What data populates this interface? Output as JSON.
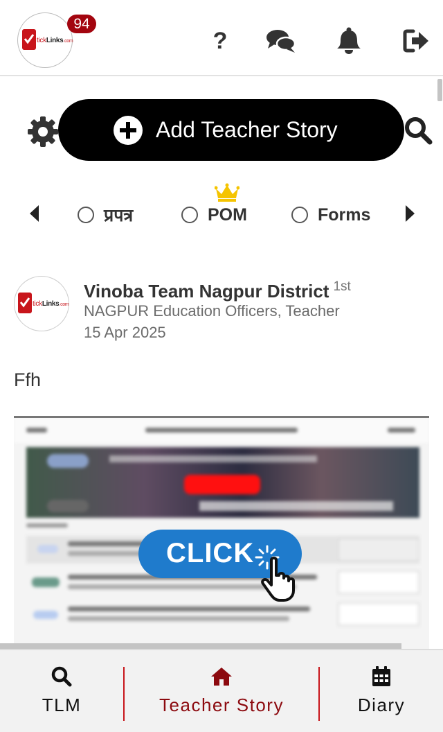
{
  "header": {
    "logo_text_a": "tick",
    "logo_text_b": "Links",
    "logo_text_c": ".com",
    "notification_count": "94",
    "icons": [
      "help-icon",
      "chat-icon",
      "bell-icon",
      "logout-icon"
    ],
    "help_glyph": "?"
  },
  "action_bar": {
    "add_story_label": "Add Teacher Story",
    "icons": [
      "settings-icon",
      "plus-circle-icon",
      "search-icon"
    ]
  },
  "categories": {
    "items": [
      {
        "label": "प्रपत्र",
        "selected": false
      },
      {
        "label": "POM",
        "selected": false,
        "premium": true
      },
      {
        "label": "Forms",
        "selected": false
      }
    ]
  },
  "post": {
    "author": "Vinoba Team Nagpur District",
    "rank": "1st",
    "subtitle": "NAGPUR Education Officers, Teacher",
    "date": "15 Apr 2025",
    "body": "Ffh",
    "media_overlay": "CLICK"
  },
  "bottom_nav": {
    "tabs": [
      {
        "label": "TLM",
        "icon": "search-icon",
        "active": false
      },
      {
        "label": "Teacher Story",
        "icon": "home-icon",
        "active": true
      },
      {
        "label": "Diary",
        "icon": "calendar-icon",
        "active": false
      }
    ]
  },
  "colors": {
    "brand_red": "#c8151b",
    "badge": "#a3050f",
    "active_tab": "#8c0a0f",
    "primary_button": "#000000",
    "click_blue": "#1f7bcc"
  }
}
